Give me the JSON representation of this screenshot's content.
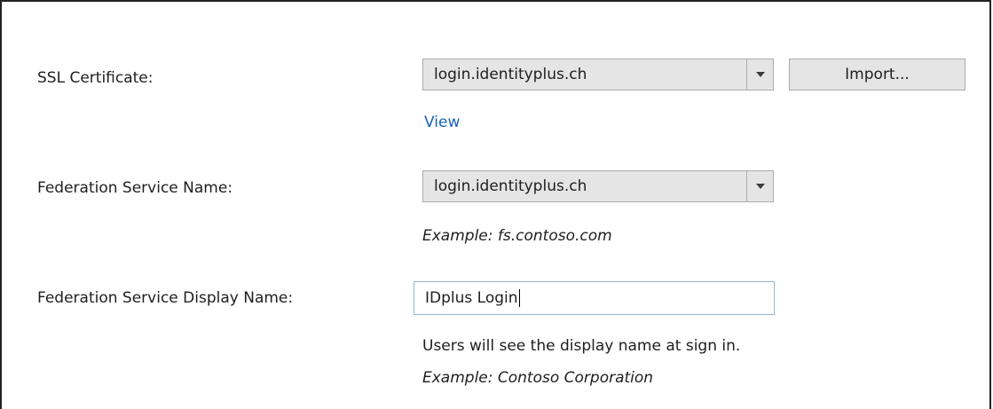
{
  "form": {
    "ssl_certificate": {
      "label": "SSL Certificate:",
      "selected_value": "login.identityplus.ch",
      "import_button_label": "Import...",
      "view_link_label": "View"
    },
    "federation_service_name": {
      "label": "Federation Service Name:",
      "selected_value": "login.identityplus.ch",
      "example": "Example: fs.contoso.com"
    },
    "federation_service_display_name": {
      "label": "Federation Service Display Name:",
      "value": "IDplus Login",
      "help_text": "Users will see the display name at sign in.",
      "example": "Example: Contoso Corporation"
    }
  },
  "icons": {
    "dropdown": "chevron-down-icon"
  },
  "colors": {
    "link": "#1a63b7",
    "control_background": "#e5e5e5",
    "control_border": "#ababab",
    "focus_border": "#93b7d6"
  }
}
